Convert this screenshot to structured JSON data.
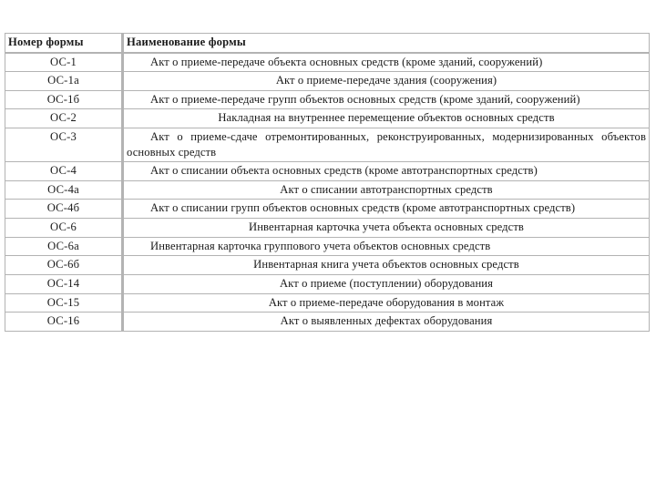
{
  "document": {
    "language": "ru",
    "background_color": "#ffffff",
    "text_color": "#1a1a1a",
    "border_color": "#b3b3b3"
  },
  "table": {
    "headers": {
      "number": "Номер формы",
      "name": "Наименование формы"
    },
    "rows": [
      {
        "number": "ОС-1",
        "name": "Акт о приеме-передаче объекта основных средств (кроме зданий, сооружений)",
        "lines": 2
      },
      {
        "number": "ОС-1а",
        "name": "Акт о приеме-передаче здания (сооружения)",
        "lines": 1
      },
      {
        "number": "ОС-1б",
        "name": "Акт о приеме-передаче групп объектов основных средств (кроме зданий, сооружений)",
        "lines": 2
      },
      {
        "number": "ОС-2",
        "name": "Накладная на внутреннее перемещение объектов основных средств",
        "lines": 1
      },
      {
        "number": "ОС-3",
        "name": "Акт о приеме-сдаче отремонтированных, реконструированных, модернизированных объектов основных средств",
        "lines": 2
      },
      {
        "number": "ОС-4",
        "name": "Акт о списании объекта основных средств (кроме автотранспортных средств)",
        "lines": 2
      },
      {
        "number": "ОС-4а",
        "name": "Акт о списании автотранспортных средств",
        "lines": 1
      },
      {
        "number": "ОС-4б",
        "name": "Акт о списании групп объектов основных средств (кроме автотранспортных средств)",
        "lines": 2
      },
      {
        "number": "ОС-6",
        "name": "Инвентарная карточка учета объекта основных средств",
        "lines": 1
      },
      {
        "number": "ОС-6а",
        "name": "Инвентарная карточка группового учета объектов основных средств",
        "lines": 2
      },
      {
        "number": "ОС-6б",
        "name": "Инвентарная книга учета объектов основных средств",
        "lines": 1
      },
      {
        "number": "ОС-14",
        "name": "Акт о приеме (поступлении) оборудования",
        "lines": 1
      },
      {
        "number": "ОС-15",
        "name": "Акт о приеме-передаче оборудования в монтаж",
        "lines": 1
      },
      {
        "number": "ОС-16",
        "name": "Акт о выявленных дефектах оборудования",
        "lines": 1
      }
    ]
  }
}
